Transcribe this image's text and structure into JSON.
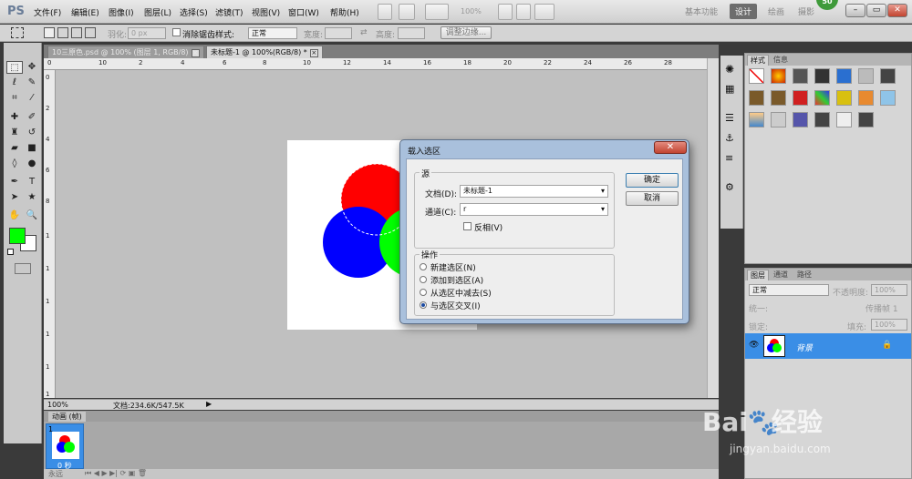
{
  "app": {
    "logo": "PS"
  },
  "menu": [
    "文件(F)",
    "编辑(E)",
    "图像(I)",
    "图层(L)",
    "选择(S)",
    "滤镜(T)",
    "视图(V)",
    "窗口(W)",
    "帮助(H)"
  ],
  "appbar": {
    "zoom": "100%"
  },
  "workspaces": {
    "essentials": "基本功能",
    "design": "设计",
    "paint": "绘画",
    "photo": "摄影",
    "badge": "50"
  },
  "options": {
    "feather_label": "羽化:",
    "feather_value": "0 px",
    "antialias_label": "消除锯齿",
    "style_label": "样式:",
    "style_value": "正常",
    "width_label": "宽度:",
    "height_label": "高度:",
    "refine_edge": "调整边缘..."
  },
  "tabs": [
    {
      "label": "10三原色.psd @ 100% (图层 1, RGB/8)"
    },
    {
      "label": "未标题-1 @ 100%(RGB/8) *"
    }
  ],
  "ruler_h": [
    "0",
    "10",
    "2",
    "4",
    "6",
    "8",
    "10",
    "12",
    "14",
    "16",
    "18",
    "20",
    "22",
    "24",
    "26",
    "28"
  ],
  "ruler_v": [
    "0",
    "2",
    "4",
    "6",
    "8",
    "1",
    "1",
    "1",
    "1",
    "1",
    "1"
  ],
  "status": {
    "zoom": "100%",
    "doc": "文档:234.6K/547.5K"
  },
  "animation": {
    "title": "动画 (帧)",
    "frame_num": "1",
    "frame_time": "0 秒",
    "loop": "永远"
  },
  "styles_panel": {
    "tab1": "样式",
    "tab2": "信息"
  },
  "layers_panel": {
    "tab1": "图层",
    "tab2": "通道",
    "tab3": "路径",
    "blend": "正常",
    "opacity_label": "不透明度:",
    "opacity": "100%",
    "unify_label": "统一:",
    "propagate": "传播帧 1",
    "lock_label": "锁定:",
    "fill_label": "填充:",
    "fill": "100%",
    "layer_name": "背景"
  },
  "dialog": {
    "title": "载入选区",
    "source_label": "源",
    "doc_label": "文档(D):",
    "doc_value": "未标题-1",
    "channel_label": "通道(C):",
    "channel_value": "r",
    "invert_label": "反相(V)",
    "operation_label": "操作",
    "ops": [
      "新建选区(N)",
      "添加到选区(A)",
      "从选区中减去(S)",
      "与选区交叉(I)"
    ],
    "ok": "确定",
    "cancel": "取消"
  },
  "watermark": {
    "brand": "Bai",
    "brand2": "经验",
    "url": "jingyan.baidu.com"
  },
  "colors": {
    "fg": "#00ff00",
    "bg": "#ffffff",
    "red": "#ff0000",
    "green": "#00ff00",
    "blue": "#0000ff",
    "layer_selected": "#3a8ee6"
  }
}
